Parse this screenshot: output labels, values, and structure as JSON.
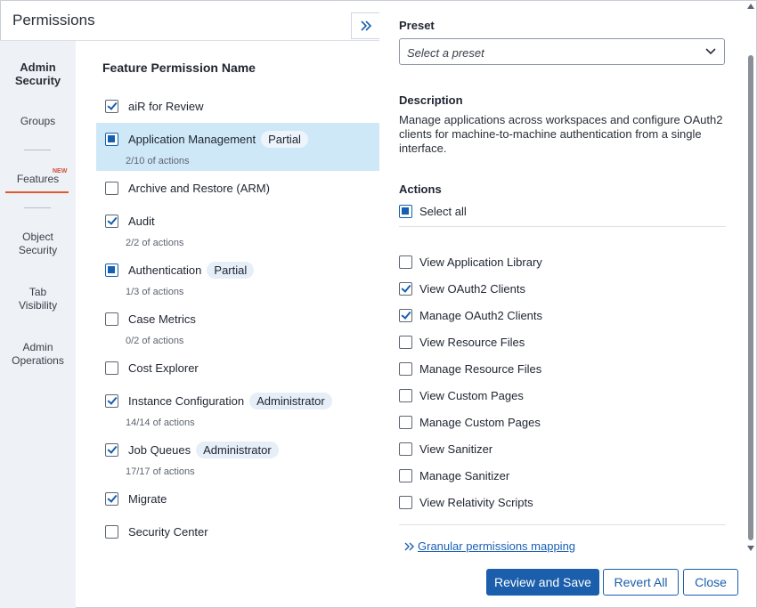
{
  "panel": {
    "title": "Permissions"
  },
  "nav": {
    "items": [
      {
        "label": "Admin Security",
        "bold": true
      },
      {
        "label": "Groups"
      },
      {
        "label": "Features",
        "badge": "NEW",
        "active": true
      },
      {
        "label": "Object Security"
      },
      {
        "label": "Tab Visibility"
      },
      {
        "label": "Admin Operations"
      }
    ]
  },
  "features": {
    "heading": "Feature Permission Name",
    "items": [
      {
        "name": "aiR for Review",
        "state": "checked"
      },
      {
        "name": "Application Management",
        "badge": "Partial",
        "sub": "2/10 of actions",
        "state": "partial",
        "selected": true
      },
      {
        "name": "Archive and Restore (ARM)",
        "state": "unchecked"
      },
      {
        "name": "Audit",
        "sub": "2/2 of actions",
        "state": "checked"
      },
      {
        "name": "Authentication",
        "badge": "Partial",
        "sub": "1/3 of actions",
        "state": "partial"
      },
      {
        "name": "Case Metrics",
        "sub": "0/2 of actions",
        "state": "unchecked"
      },
      {
        "name": "Cost Explorer",
        "state": "unchecked"
      },
      {
        "name": "Instance Configuration",
        "badge": "Administrator",
        "sub": "14/14 of actions",
        "state": "checked"
      },
      {
        "name": "Job Queues",
        "badge": "Administrator",
        "sub": "17/17 of actions",
        "state": "checked"
      },
      {
        "name": "Migrate",
        "state": "checked"
      },
      {
        "name": "Security Center",
        "state": "unchecked"
      }
    ]
  },
  "detail": {
    "preset_label": "Preset",
    "preset_placeholder": "Select a preset",
    "description_label": "Description",
    "description": "Manage applications across workspaces and configure OAuth2 clients for machine-to-machine authentication from a single interface.",
    "actions_label": "Actions",
    "select_all": "Select all",
    "actions": [
      {
        "name": "View Application Library",
        "checked": false
      },
      {
        "name": "View OAuth2 Clients",
        "checked": true
      },
      {
        "name": "Manage OAuth2 Clients",
        "checked": true
      },
      {
        "name": "View Resource Files",
        "checked": false
      },
      {
        "name": "Manage Resource Files",
        "checked": false
      },
      {
        "name": "View Custom Pages",
        "checked": false
      },
      {
        "name": "Manage Custom Pages",
        "checked": false
      },
      {
        "name": "View Sanitizer",
        "checked": false
      },
      {
        "name": "Manage Sanitizer",
        "checked": false
      },
      {
        "name": "View Relativity Scripts",
        "checked": false
      }
    ],
    "mapping_link": "Granular permissions mapping"
  },
  "footer": {
    "review_save": "Review and Save",
    "revert_all": "Revert All",
    "close": "Close"
  },
  "colors": {
    "accent": "#1b5eab",
    "selected_row": "#cfe8f8",
    "nav_bg": "#eef1f5",
    "active_underline": "#e0582f"
  }
}
